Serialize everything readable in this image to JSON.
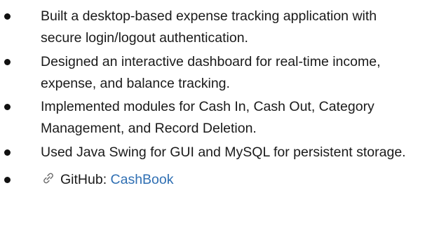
{
  "bullets": [
    {
      "text": "Built a desktop-based expense tracking application with secure login/logout authentication."
    },
    {
      "text": "Designed an interactive dashboard for real-time income, expense, and balance tracking."
    },
    {
      "text": "Implemented modules for Cash In, Cash Out, Category Management, and Record Deletion."
    },
    {
      "text": "Used Java Swing for GUI and MySQL for persistent storage."
    }
  ],
  "github": {
    "icon": "link-icon",
    "label": "GitHub: ",
    "link_text": "CashBook",
    "link_color": "#2f6fb3"
  }
}
